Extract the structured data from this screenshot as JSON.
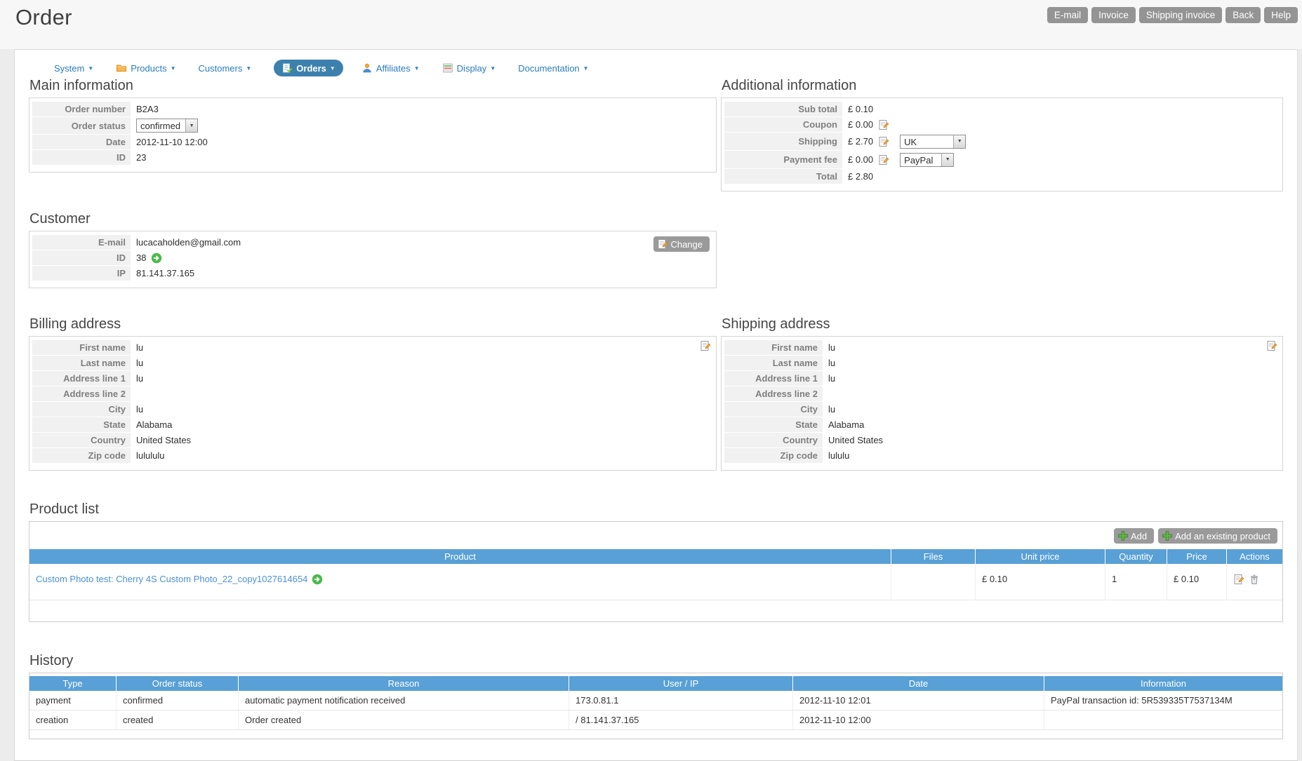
{
  "page": {
    "title": "Order"
  },
  "toolbar": {
    "email": "E-mail",
    "invoice": "Invoice",
    "shipping_invoice": "Shipping invoice",
    "back": "Back",
    "help": "Help"
  },
  "nav": {
    "system": "System",
    "products": "Products",
    "customers": "Customers",
    "orders": "Orders",
    "affiliates": "Affiliates",
    "display": "Display",
    "documentation": "Documentation"
  },
  "main_information": {
    "heading": "Main information",
    "order_number_label": "Order number",
    "order_number": "B2A3",
    "order_status_label": "Order status",
    "order_status": "confirmed",
    "date_label": "Date",
    "date": "2012-11-10 12:00",
    "id_label": "ID",
    "id": "23"
  },
  "additional_information": {
    "heading": "Additional information",
    "sub_total_label": "Sub total",
    "sub_total": "£ 0.10",
    "coupon_label": "Coupon",
    "coupon": "£ 0.00",
    "shipping_label": "Shipping",
    "shipping": "£ 2.70",
    "shipping_country": "UK",
    "payment_fee_label": "Payment fee",
    "payment_fee": "£ 0.00",
    "payment_method": "PayPal",
    "total_label": "Total",
    "total": "£ 2.80"
  },
  "customer": {
    "heading": "Customer",
    "email_label": "E-mail",
    "email": "lucacaholden@gmail.com",
    "id_label": "ID",
    "id": "38",
    "ip_label": "IP",
    "ip": "81.141.37.165",
    "change_button": "Change"
  },
  "billing_address": {
    "heading": "Billing address",
    "rows": [
      {
        "label": "First name",
        "value": "lu"
      },
      {
        "label": "Last name",
        "value": "lu"
      },
      {
        "label": "Address line 1",
        "value": "lu"
      },
      {
        "label": "Address line 2",
        "value": ""
      },
      {
        "label": "City",
        "value": "lu"
      },
      {
        "label": "State",
        "value": "Alabama"
      },
      {
        "label": "Country",
        "value": "United States"
      },
      {
        "label": "Zip code",
        "value": "lulululu"
      }
    ]
  },
  "shipping_address": {
    "heading": "Shipping address",
    "rows": [
      {
        "label": "First name",
        "value": "lu"
      },
      {
        "label": "Last name",
        "value": "lu"
      },
      {
        "label": "Address line 1",
        "value": "lu"
      },
      {
        "label": "Address line 2",
        "value": ""
      },
      {
        "label": "City",
        "value": "lu"
      },
      {
        "label": "State",
        "value": "Alabama"
      },
      {
        "label": "Country",
        "value": "United States"
      },
      {
        "label": "Zip code",
        "value": "lululu"
      }
    ]
  },
  "product_list": {
    "heading": "Product list",
    "add_button": "Add",
    "add_existing_button": "Add an existing product",
    "headers": {
      "product": "Product",
      "files": "Files",
      "unit_price": "Unit price",
      "quantity": "Quantity",
      "price": "Price",
      "actions": "Actions"
    },
    "rows": [
      {
        "product": "Custom Photo test: Cherry 4S Custom Photo_22_copy1027614654",
        "files": "",
        "unit_price": "£ 0.10",
        "quantity": "1",
        "price": "£ 0.10"
      }
    ]
  },
  "history": {
    "heading": "History",
    "headers": {
      "type": "Type",
      "order_status": "Order status",
      "reason": "Reason",
      "user_ip": "User / IP",
      "date": "Date",
      "information": "Information"
    },
    "rows": [
      {
        "type": "payment",
        "status": "confirmed",
        "reason": "automatic payment notification received",
        "user_ip": "173.0.81.1",
        "date": "2012-11-10 12:01",
        "info": "PayPal transaction id: 5R539335T7537134M"
      },
      {
        "type": "creation",
        "status": "created",
        "reason": "Order created",
        "user_ip": "/ 81.141.37.165",
        "date": "2012-11-10 12:00",
        "info": ""
      }
    ]
  },
  "colors": {
    "table_header_blue": "#58a0d6",
    "nav_active_blue": "#3c80ae",
    "nav_link_blue": "#2b7cbd",
    "button_gray": "#949494",
    "product_link_blue": "#4a90d9"
  }
}
